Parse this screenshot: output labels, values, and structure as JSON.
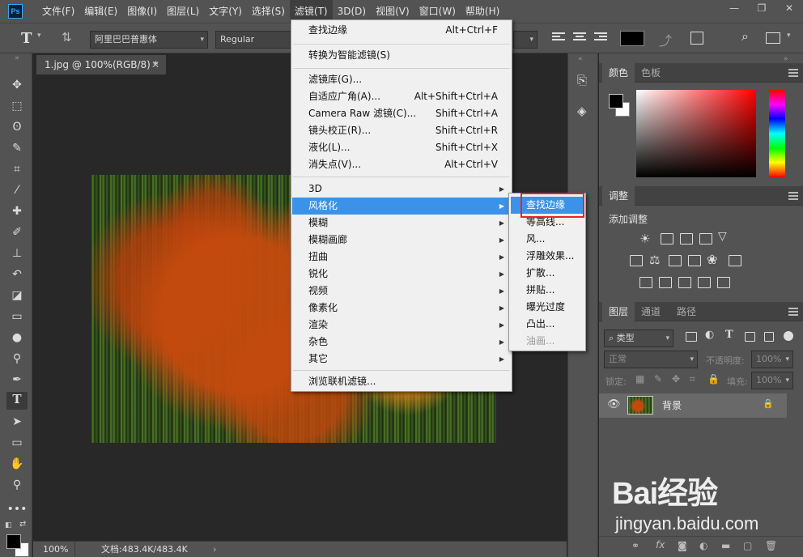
{
  "app": {
    "logo": "Ps"
  },
  "menubar": {
    "items": [
      "文件(F)",
      "编辑(E)",
      "图像(I)",
      "图层(L)",
      "文字(Y)",
      "选择(S)",
      "滤镜(T)",
      "3D(D)",
      "视图(V)",
      "窗口(W)",
      "帮助(H)"
    ],
    "active_index": 6
  },
  "optionsbar": {
    "font_family": "阿里巴巴普惠体",
    "font_style": "Regular",
    "tool_text_icon": "T"
  },
  "document": {
    "tab_title": "1.jpg @ 100%(RGB/8) *",
    "zoom": "100%",
    "doc_info": "文档:483.4K/483.4K"
  },
  "filter_menu": {
    "items": [
      {
        "label": "查找边缘",
        "shortcut": "Alt+Ctrl+F"
      },
      {
        "label": "转换为智能滤镜(S)",
        "shortcut": ""
      },
      {
        "label": "滤镜库(G)...",
        "shortcut": ""
      },
      {
        "label": "自适应广角(A)...",
        "shortcut": "Alt+Shift+Ctrl+A"
      },
      {
        "label": "Camera Raw 滤镜(C)...",
        "shortcut": "Shift+Ctrl+A"
      },
      {
        "label": "镜头校正(R)...",
        "shortcut": "Shift+Ctrl+R"
      },
      {
        "label": "液化(L)...",
        "shortcut": "Shift+Ctrl+X"
      },
      {
        "label": "消失点(V)...",
        "shortcut": "Alt+Ctrl+V"
      },
      {
        "label": "3D",
        "submenu": true
      },
      {
        "label": "风格化",
        "submenu": true
      },
      {
        "label": "模糊",
        "submenu": true
      },
      {
        "label": "模糊画廊",
        "submenu": true
      },
      {
        "label": "扭曲",
        "submenu": true
      },
      {
        "label": "锐化",
        "submenu": true
      },
      {
        "label": "视频",
        "submenu": true
      },
      {
        "label": "像素化",
        "submenu": true
      },
      {
        "label": "渲染",
        "submenu": true
      },
      {
        "label": "杂色",
        "submenu": true
      },
      {
        "label": "其它",
        "submenu": true
      },
      {
        "label": "浏览联机滤镜...",
        "shortcut": ""
      }
    ],
    "highlighted": "风格化"
  },
  "stylize_submenu": {
    "items": [
      "查找边缘",
      "等高线...",
      "风...",
      "浮雕效果...",
      "扩散...",
      "拼贴...",
      "曝光过度",
      "凸出...",
      "油画..."
    ],
    "highlighted": "查找边缘",
    "disabled": "油画..."
  },
  "panels": {
    "color": {
      "tabs": [
        "颜色",
        "色板"
      ],
      "active": "颜色"
    },
    "adjustments": {
      "title": "调整",
      "add_label": "添加调整"
    },
    "layers": {
      "tabs": [
        "图层",
        "通道",
        "路径"
      ],
      "active": "图层",
      "filter_kind": "类型",
      "blend_mode": "正常",
      "opacity_label": "不透明度:",
      "opacity_value": "100%",
      "lock_label": "锁定:",
      "fill_label": "填充:",
      "fill_value": "100%",
      "layer_name": "背景"
    }
  },
  "watermark": {
    "logo": "Bai经验",
    "sub": "jingyan.baidu.com"
  },
  "colors": {
    "highlight": "#3b92e8",
    "redbox": "#e42727"
  }
}
